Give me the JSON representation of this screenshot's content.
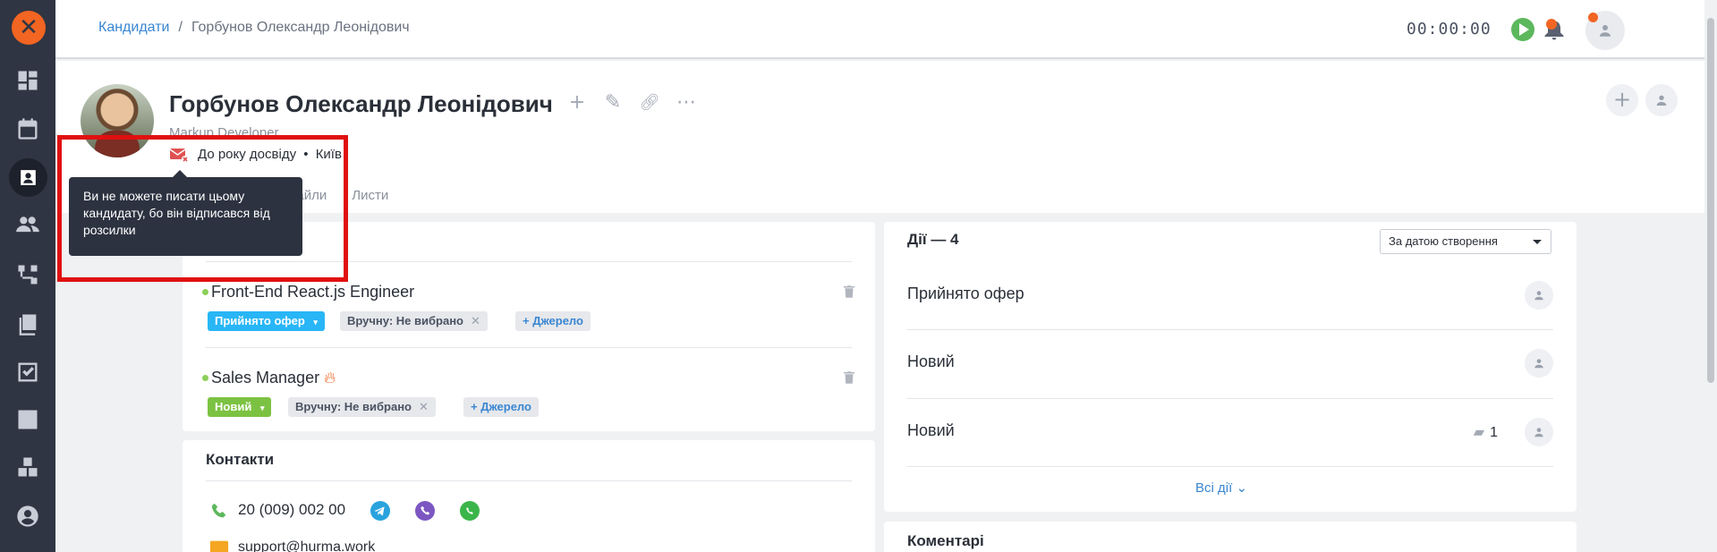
{
  "breadcrumb": {
    "parent": "Кандидати",
    "separator": "/",
    "current": "Горбунов Олександр Леонідович"
  },
  "topbar": {
    "timer": "00:00:00"
  },
  "candidate": {
    "name": "Горбунов Олександр Леонідович",
    "position": "Markup Developer",
    "experience": "До року досвіду",
    "city": "Київ",
    "meta_dot": "•"
  },
  "tabs": [
    "Файли",
    "Листи"
  ],
  "tooltip": {
    "text": "Ви не можете писати цьому кандидату, бо він відписався від розсилки"
  },
  "vacancies": [
    {
      "title": "Front-End React.js Engineer",
      "status": "Прийнято офер",
      "manual": "Вручну: Не вибрано",
      "source": "Джерело",
      "hot": false
    },
    {
      "title": "Sales Manager",
      "status": "Новий",
      "manual": "Вручну: Не вибрано",
      "source": "Джерело",
      "hot": true
    }
  ],
  "contacts": {
    "title": "Контакти",
    "phone": "20 (009) 002 00",
    "email": "support@hurma.work"
  },
  "actions": {
    "title": "Дії — 4",
    "sort": "За датою створення",
    "items": [
      {
        "label": "Прийнято офер",
        "comments": ""
      },
      {
        "label": "Новий",
        "comments": ""
      },
      {
        "label": "Новий",
        "comments": "1"
      }
    ],
    "all": "Всі дії"
  },
  "comments": {
    "title": "Коментарі"
  },
  "colors": {
    "accent": "#f26522",
    "link": "#3a86d1",
    "sidebar": "#2f3542",
    "highlight": "#e01010"
  }
}
